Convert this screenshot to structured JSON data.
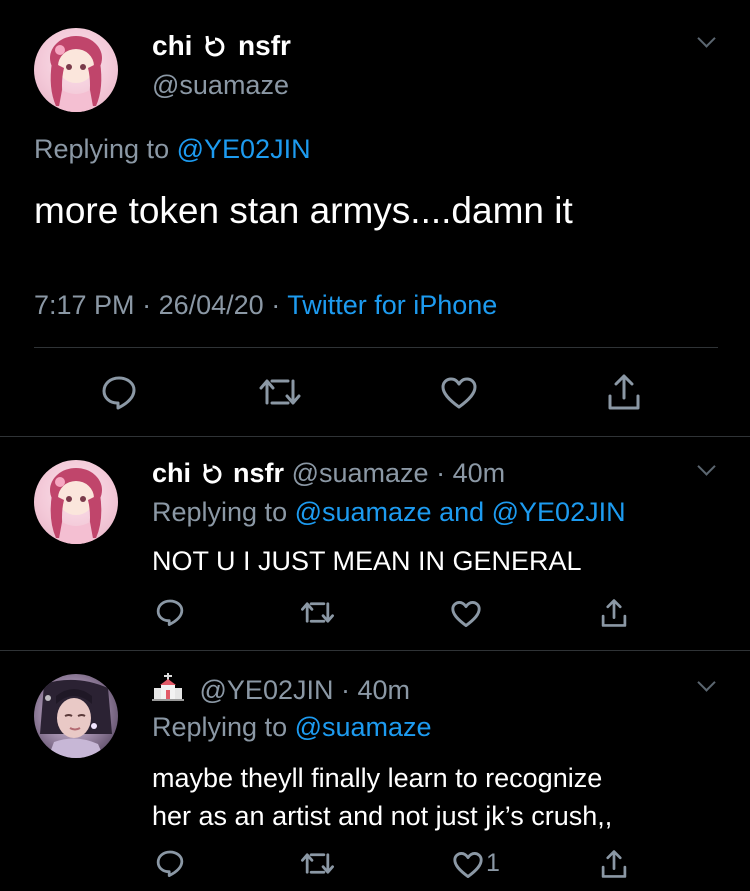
{
  "main_tweet": {
    "display_name": "chi",
    "name_suffix": "nsfr",
    "handle": "@suamaze",
    "replying_prefix": "Replying to",
    "replying_to": "@YE02JIN",
    "text": "more token stan armys....damn it",
    "time": "7:17 PM",
    "date": "26/04/20",
    "source": "Twitter for iPhone"
  },
  "reply_1": {
    "display_name": "chi",
    "name_suffix": "nsfr",
    "handle": "@suamaze",
    "age": "40m",
    "replying_prefix": "Replying to",
    "replying_to": "@suamaze and @YE02JIN",
    "text": "NOT U I JUST MEAN IN GENERAL"
  },
  "reply_2": {
    "display_name_emoji": "church-emoji",
    "handle": "@YE02JIN",
    "age": "40m",
    "replying_prefix": "Replying to",
    "replying_to": "@suamaze",
    "text_line1": "maybe theyll finally learn to recognize",
    "text_line2": "her as an artist and not just jk’s crush,,",
    "like_count": "1"
  },
  "separator": "·",
  "colors": {
    "background": "#000000",
    "muted": "#8b98a5",
    "link": "#1d9bf0",
    "divider": "#2f3336"
  },
  "icons": [
    "reply-icon",
    "retweet-icon",
    "like-icon",
    "share-icon",
    "chevron-down-icon"
  ]
}
